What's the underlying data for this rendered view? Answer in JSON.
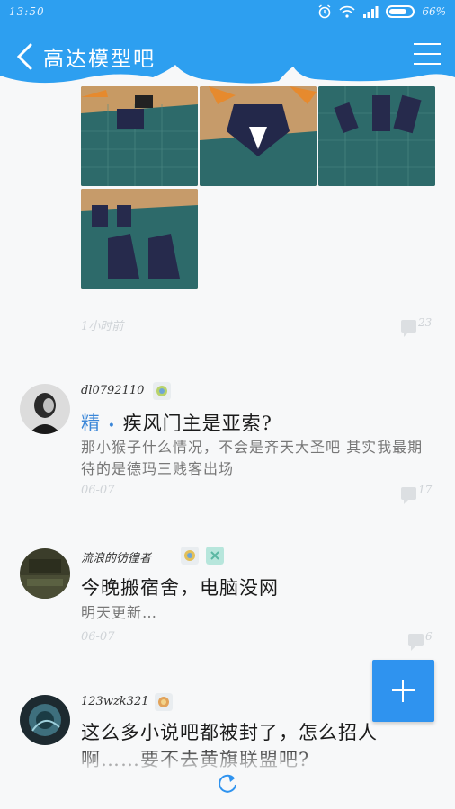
{
  "status_bar": {
    "time": "13:50",
    "battery": "66%"
  },
  "header": {
    "title": "高达模型吧"
  },
  "posts": [
    {
      "time": "1小时前",
      "comments": "23"
    },
    {
      "username": "dl0792110",
      "tag": "精",
      "title": "疾风门主是亚索?",
      "body": "那小猴子什么情况，不会是齐天大圣吧 其实我最期待的是德玛三贱客出场",
      "time": "06-07",
      "comments": "17"
    },
    {
      "username": "流浪的彷徨者",
      "title": "今晚搬宿舍，电脑没网",
      "body": "明天更新…",
      "time": "06-07",
      "comments": "6"
    },
    {
      "username": "123wzk321",
      "title": "这么多小说吧都被封了，怎么招人",
      "title_line2": "啊……要不去黄旗联盟吧?"
    }
  ],
  "colors": {
    "brand_blue": "#2d9ff0",
    "fab_blue": "#2f93ef",
    "tag_blue": "#3a86d8"
  }
}
